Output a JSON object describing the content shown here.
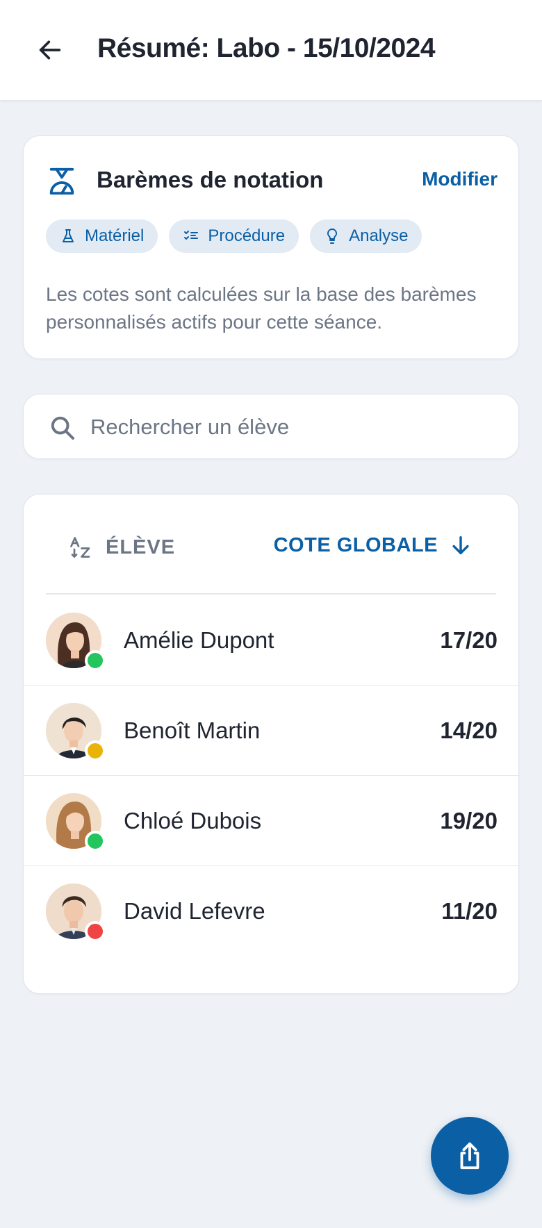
{
  "header": {
    "title": "Résumé: Labo - 15/10/2024"
  },
  "grading": {
    "title": "Barèmes de notation",
    "modify_label": "Modifier",
    "chips": [
      "Matériel",
      "Procédure",
      "Analyse"
    ],
    "description": "Les cotes sont calculées sur la base des barèmes personnalisés actifs pour cette séance."
  },
  "search": {
    "placeholder": "Rechercher un élève"
  },
  "list": {
    "header_student": "ÉLÈVE",
    "header_grade": "COTE GLOBALE",
    "students": [
      {
        "name": "Amélie Dupont",
        "grade": "17/20",
        "status_color": "#22c55e"
      },
      {
        "name": "Benoît Martin",
        "grade": "14/20",
        "status_color": "#eab308"
      },
      {
        "name": "Chloé Dubois",
        "grade": "19/20",
        "status_color": "#22c55e"
      },
      {
        "name": "David Lefevre",
        "grade": "11/20",
        "status_color": "#ef4444"
      }
    ]
  },
  "colors": {
    "accent": "#0b5fa5",
    "background": "#eef1f5"
  },
  "icons": {
    "back": "arrow-left-icon",
    "grading": "scale-icon",
    "chips": [
      "flask-icon",
      "checklist-icon",
      "lightbulb-icon"
    ],
    "search": "search-icon",
    "sort_name": "sort-az-icon",
    "sort_grade": "arrow-down-icon",
    "fab": "share-icon"
  }
}
